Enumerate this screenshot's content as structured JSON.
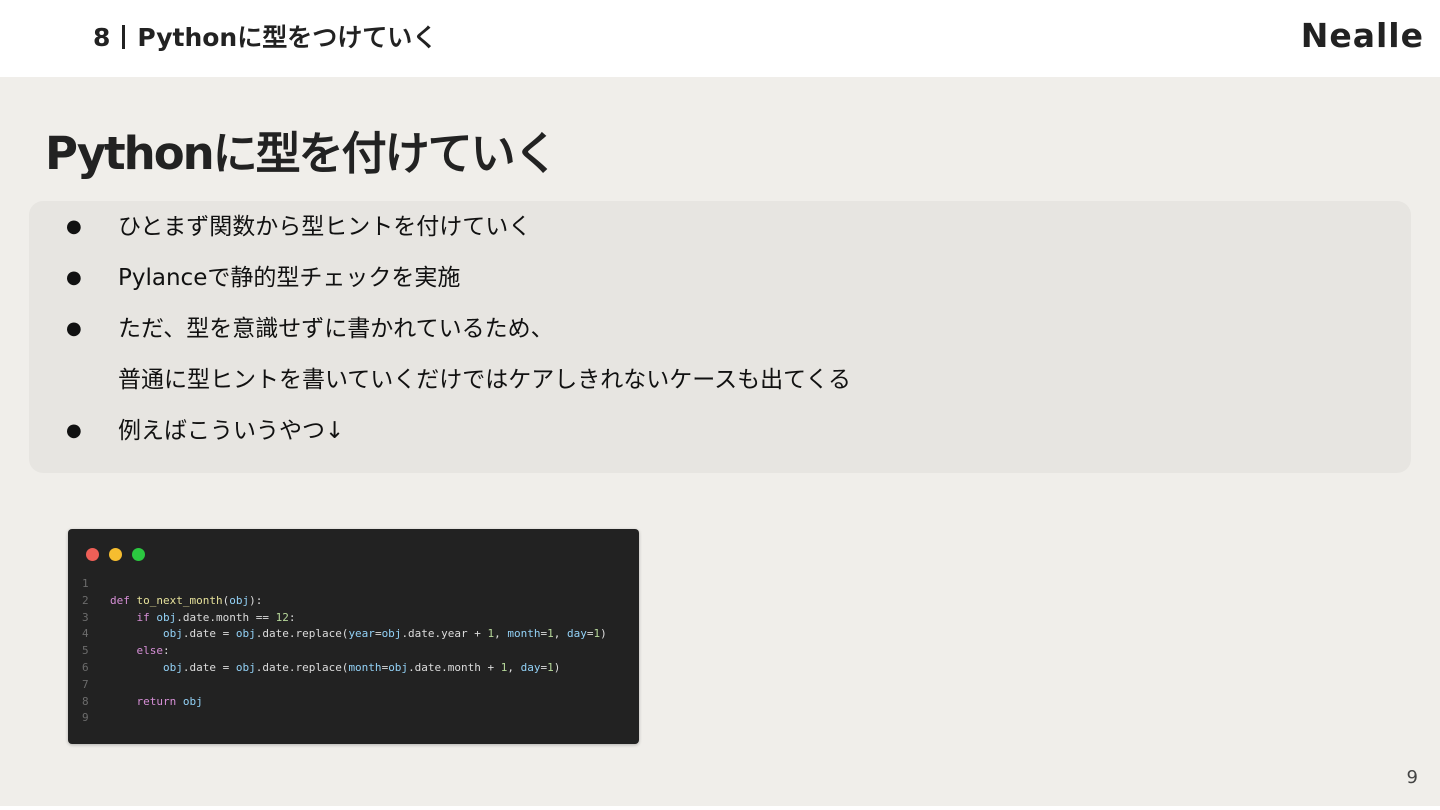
{
  "header": {
    "section_number": "8",
    "section_title": "Pythonに型をつけていく",
    "logo": "Nealle"
  },
  "slide": {
    "title": "Pythonに型を付けていく",
    "bullets": [
      {
        "marker": "●",
        "text": "ひとまず関数から型ヒントを付けていく"
      },
      {
        "marker": "●",
        "text": "Pylanceで静的型チェックを実施"
      },
      {
        "marker": "●",
        "text": "ただ、型を意識せずに書かれているため、"
      },
      {
        "marker": "",
        "text": "普通に型ヒントを書いていくだけではケアしきれないケースも出てくる"
      },
      {
        "marker": "●",
        "text": "例えばこういうやつ↓"
      }
    ],
    "page_number": "9"
  },
  "code": {
    "window_buttons": [
      "close",
      "minimize",
      "maximize"
    ],
    "colors": {
      "keyword": "#d68fd6",
      "function": "#e5e09a",
      "variable": "#92d1f6",
      "number": "#b7d89a",
      "plain": "#dcdcdc"
    },
    "lines": [
      {
        "n": "1",
        "tokens": []
      },
      {
        "n": "2",
        "tokens": [
          [
            "kw",
            "def"
          ],
          [
            "plain",
            " "
          ],
          [
            "fn",
            "to_next_month"
          ],
          [
            "plain",
            "("
          ],
          [
            "var",
            "obj"
          ],
          [
            "plain",
            "):"
          ]
        ]
      },
      {
        "n": "3",
        "tokens": [
          [
            "plain",
            "    "
          ],
          [
            "kw",
            "if"
          ],
          [
            "plain",
            " "
          ],
          [
            "var",
            "obj"
          ],
          [
            "plain",
            ".date.month == "
          ],
          [
            "num",
            "12"
          ],
          [
            "plain",
            ":"
          ]
        ]
      },
      {
        "n": "4",
        "tokens": [
          [
            "plain",
            "        "
          ],
          [
            "var",
            "obj"
          ],
          [
            "plain",
            ".date = "
          ],
          [
            "var",
            "obj"
          ],
          [
            "plain",
            ".date.replace("
          ],
          [
            "var",
            "year"
          ],
          [
            "plain",
            "="
          ],
          [
            "var",
            "obj"
          ],
          [
            "plain",
            ".date.year + "
          ],
          [
            "num",
            "1"
          ],
          [
            "plain",
            ", "
          ],
          [
            "var",
            "month"
          ],
          [
            "plain",
            "="
          ],
          [
            "num",
            "1"
          ],
          [
            "plain",
            ", "
          ],
          [
            "var",
            "day"
          ],
          [
            "plain",
            "="
          ],
          [
            "num",
            "1"
          ],
          [
            "plain",
            ")"
          ]
        ]
      },
      {
        "n": "5",
        "tokens": [
          [
            "plain",
            "    "
          ],
          [
            "kw",
            "else"
          ],
          [
            "plain",
            ":"
          ]
        ]
      },
      {
        "n": "6",
        "tokens": [
          [
            "plain",
            "        "
          ],
          [
            "var",
            "obj"
          ],
          [
            "plain",
            ".date = "
          ],
          [
            "var",
            "obj"
          ],
          [
            "plain",
            ".date.replace("
          ],
          [
            "var",
            "month"
          ],
          [
            "plain",
            "="
          ],
          [
            "var",
            "obj"
          ],
          [
            "plain",
            ".date.month + "
          ],
          [
            "num",
            "1"
          ],
          [
            "plain",
            ", "
          ],
          [
            "var",
            "day"
          ],
          [
            "plain",
            "="
          ],
          [
            "num",
            "1"
          ],
          [
            "plain",
            ")"
          ]
        ]
      },
      {
        "n": "7",
        "tokens": []
      },
      {
        "n": "8",
        "tokens": [
          [
            "plain",
            "    "
          ],
          [
            "kw",
            "return"
          ],
          [
            "plain",
            " "
          ],
          [
            "var",
            "obj"
          ]
        ]
      },
      {
        "n": "9",
        "tokens": []
      }
    ]
  }
}
